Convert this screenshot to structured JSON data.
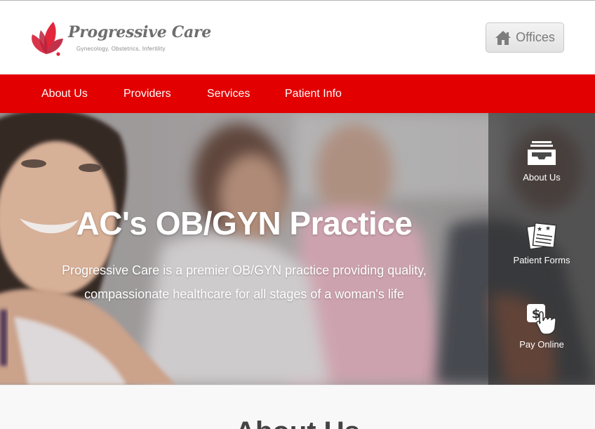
{
  "brand": {
    "name": "Progressive Care",
    "tagline": "Gynecology, Obstetrics, Infertility",
    "logo_icon": "lotus-petals-icon",
    "colors": {
      "petal_primary": "#e3263b",
      "petal_secondary": "#c2324a",
      "text": "#6e6e6e"
    }
  },
  "header": {
    "offices_button": {
      "label": "Offices",
      "icon": "home-icon"
    }
  },
  "nav": {
    "background": "#e30000",
    "items": [
      {
        "label": "About Us"
      },
      {
        "label": "Providers"
      },
      {
        "label": "Services"
      },
      {
        "label": "Patient Info"
      }
    ]
  },
  "hero": {
    "title": "AC's OB/GYN Practice",
    "subtitle": "Progressive Care is a premier OB/GYN practice providing quality, compassionate healthcare for all stages of a woman's life"
  },
  "side_panel": {
    "items": [
      {
        "label": "About Us",
        "icon": "inbox-tray-icon"
      },
      {
        "label": "Patient Forms",
        "icon": "forms-documents-icon"
      },
      {
        "label": "Pay Online",
        "icon": "dollar-hand-pointer-icon"
      }
    ]
  },
  "about_section": {
    "heading": "About Us"
  }
}
